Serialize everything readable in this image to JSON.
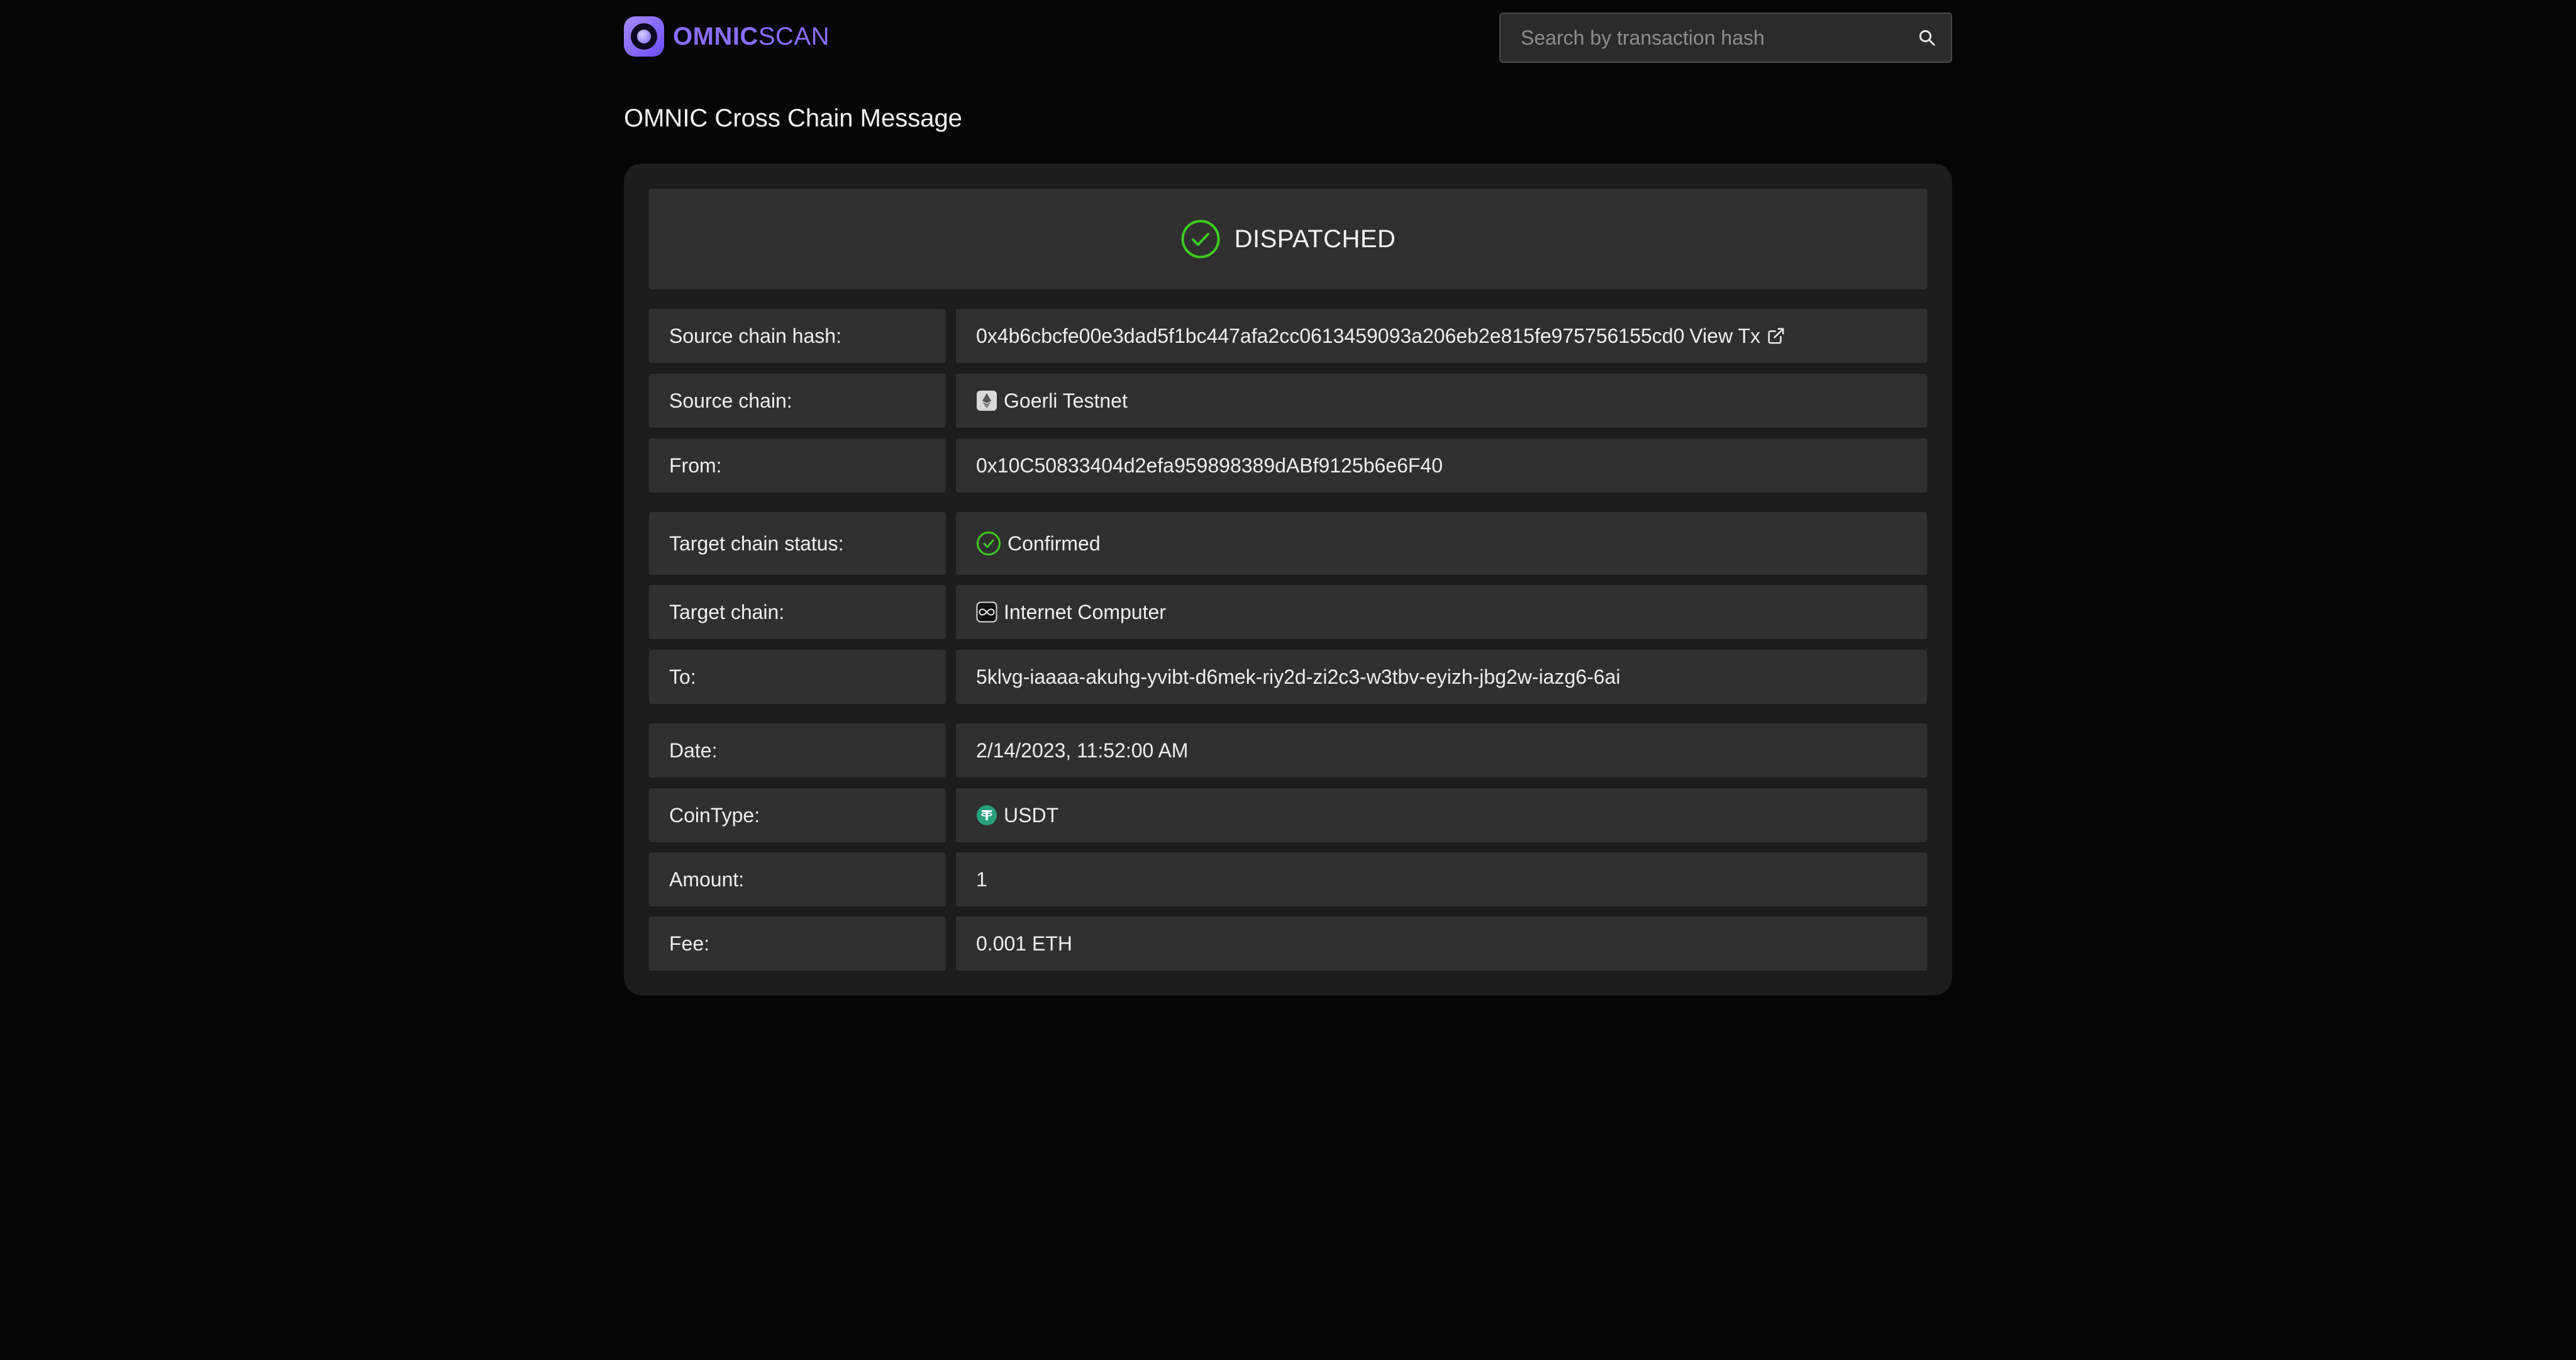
{
  "header": {
    "logo_bold": "OMNIC",
    "logo_light": "SCAN",
    "search_placeholder": "Search by transaction hash"
  },
  "page_title": "OMNIC Cross Chain Message",
  "status": {
    "label": "DISPATCHED",
    "color": "#3ecb1f"
  },
  "rows": {
    "source_hash": {
      "label": "Source chain hash:",
      "value": "0x4b6cbcfe00e3dad5f1bc447afa2cc0613459093a206eb2e815fe975756155cd0",
      "link": "View Tx",
      "icon": "external-link-icon"
    },
    "source_chain": {
      "label": "Source chain:",
      "value": "Goerli Testnet",
      "icon": "ethereum-icon"
    },
    "from": {
      "label": "From:",
      "value": "0x10C50833404d2efa959898389dABf9125b6e6F40"
    },
    "target_status": {
      "label": "Target chain status:",
      "value": "Confirmed",
      "icon": "check-circle-icon"
    },
    "target_chain": {
      "label": "Target chain:",
      "value": "Internet Computer",
      "icon": "infinity-icon"
    },
    "to": {
      "label": "To:",
      "value": "5klvg-iaaaa-akuhg-yvibt-d6mek-riy2d-zi2c3-w3tbv-eyizh-jbg2w-iazg6-6ai"
    },
    "date": {
      "label": "Date:",
      "value": "2/14/2023, 11:52:00 AM"
    },
    "coin_type": {
      "label": "CoinType:",
      "value": "USDT",
      "icon": "tether-icon",
      "icon_color": "#26a17b"
    },
    "amount": {
      "label": "Amount:",
      "value": "1"
    },
    "fee": {
      "label": "Fee:",
      "value": "0.001 ETH"
    }
  },
  "colors": {
    "background": "#060606",
    "card": "#1d1d1d",
    "cell": "#303030",
    "accent": "#8a6dff",
    "success": "#3ecb1f"
  }
}
